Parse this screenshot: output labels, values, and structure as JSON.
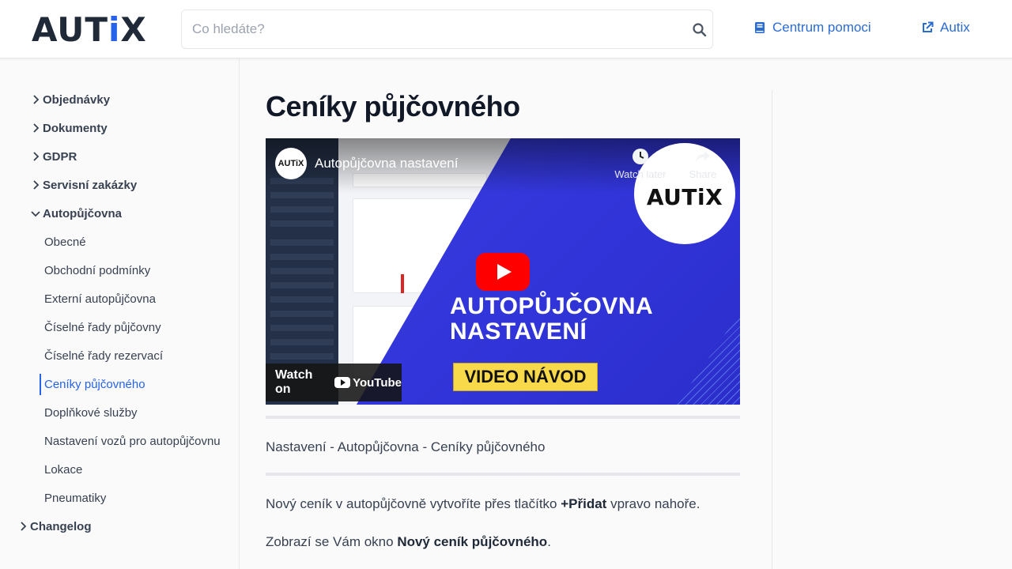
{
  "header": {
    "logo": {
      "a": "AUT",
      "i": "i",
      "x": "X"
    },
    "search_placeholder": "Co hledáte?",
    "help_link": "Centrum pomoci",
    "external_link": "Autix"
  },
  "sidebar": {
    "groups": [
      {
        "label": "Objednávky",
        "expanded": false
      },
      {
        "label": "Dokumenty",
        "expanded": false
      },
      {
        "label": "GDPR",
        "expanded": false
      },
      {
        "label": "Servisní zakázky",
        "expanded": false
      },
      {
        "label": "Autopůjčovna",
        "expanded": true
      }
    ],
    "subitems": [
      "Obecné",
      "Obchodní podmínky",
      "Externí autopůjčovna",
      "Číselné řady půjčovny",
      "Číselné řady rezervací",
      "Ceníky půjčovného",
      "Doplňkové služby",
      "Nastavení vozů pro autopůjčovnu",
      "Lokace",
      "Pneumatiky"
    ],
    "active": "Ceníky půjčovného",
    "changelog": "Changelog"
  },
  "main": {
    "title": "Ceníky půjčovného",
    "video": {
      "channel": "AUTiX",
      "title": "Autopůjčovna nastavení",
      "watch_later": "Watch later",
      "share": "Share",
      "thumb_brand": "AUTiX",
      "headline_1": "AUTOPŮJČOVNA",
      "headline_2": "NASTAVENÍ",
      "badge": "VIDEO NÁVOD",
      "watch_on": "Watch on",
      "youtube": "YouTube"
    },
    "breadcrumb_text": "Nastavení - Autopůjčovna - Ceníky půjčovného",
    "p1": {
      "before": "Nový ceník v autopůjčovně vytvoříte přes tlačítko ",
      "bold": "+Přidat",
      "after": " vpravo nahoře."
    },
    "p2": {
      "before": "Zobrazí se Vám okno ",
      "bold": "Nový ceník půjčovného",
      "after": "."
    }
  },
  "colors": {
    "accent": "#2563eb",
    "video_blue": "#3a3fe2",
    "badge_yellow": "#f8d94a",
    "youtube_red": "#ff0000"
  }
}
